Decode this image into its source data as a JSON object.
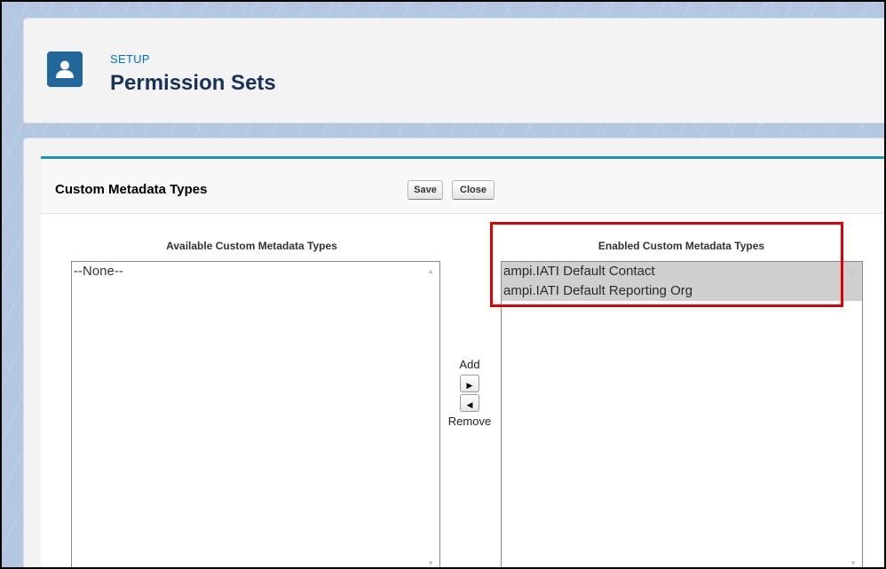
{
  "header": {
    "icon": "person-icon",
    "breadcrumb": "SETUP",
    "title": "Permission Sets"
  },
  "section": {
    "title": "Custom Metadata Types",
    "save_label": "Save",
    "close_label": "Close"
  },
  "available": {
    "label": "Available Custom Metadata Types",
    "options": [
      "--None--"
    ]
  },
  "enabled": {
    "label": "Enabled Custom Metadata Types",
    "options": [
      "ampi.IATI Default Contact",
      "ampi.IATI Default Reporting Org"
    ]
  },
  "mover": {
    "add_label": "Add",
    "add_icon": "arrow-right-icon",
    "remove_icon": "arrow-left-icon",
    "remove_label": "Remove"
  },
  "colors": {
    "header_icon_bg": "#21679b",
    "setup_link": "#0070d2",
    "highlight_border": "#e00000",
    "pb_accent": "#1797c0"
  }
}
